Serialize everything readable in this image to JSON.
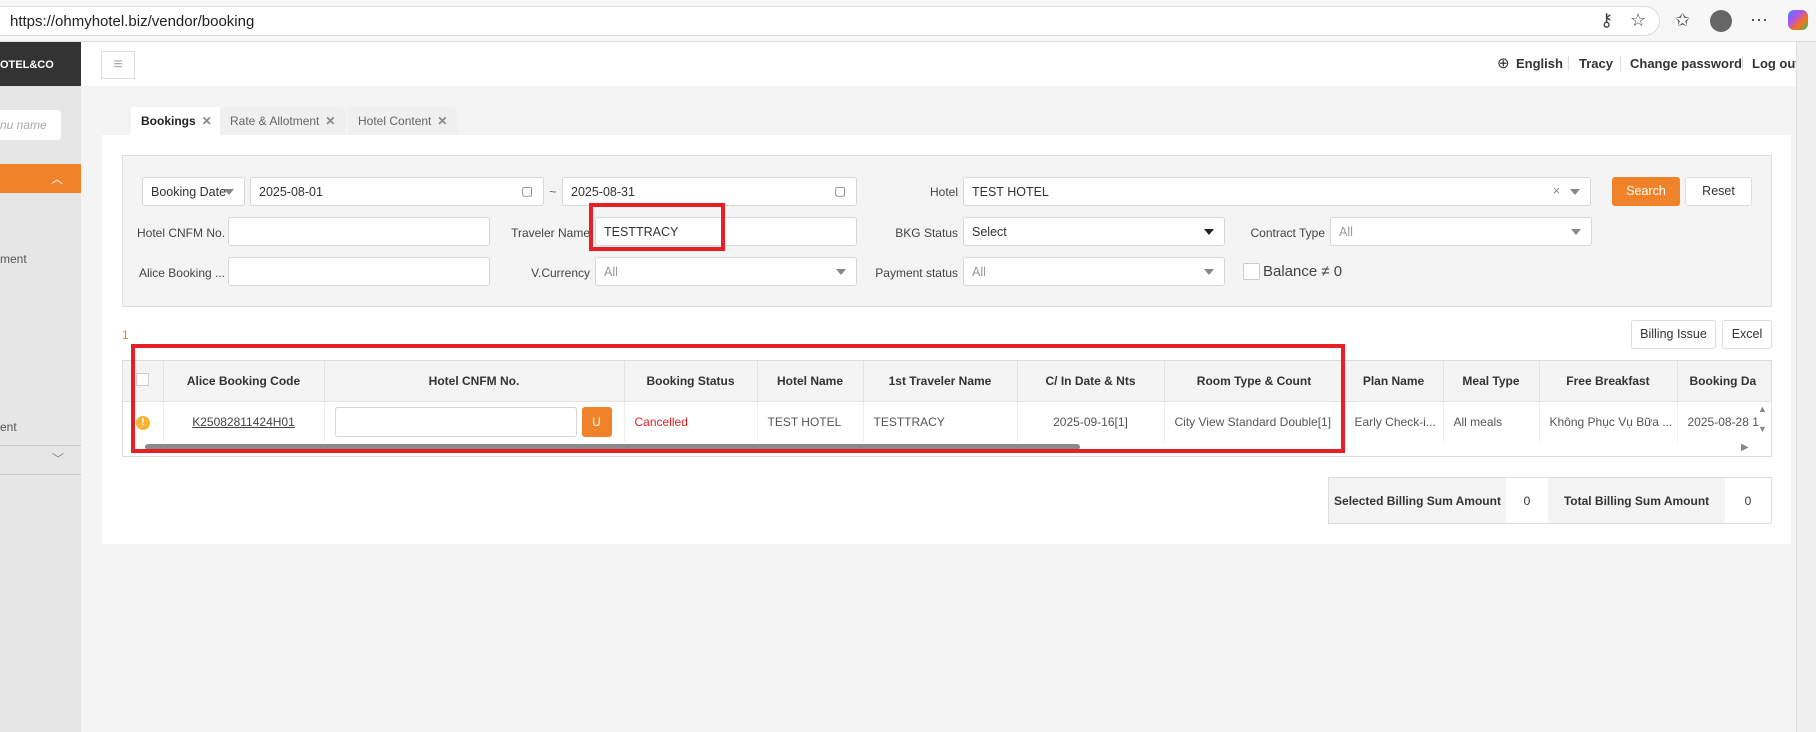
{
  "browser": {
    "url": "https://ohmyhotel.biz/vendor/booking"
  },
  "sidebar": {
    "logo": "OTEL&CO",
    "search_placeholder": "nu name",
    "items": [
      "ment",
      "ent"
    ]
  },
  "header": {
    "language": "English",
    "user": "Tracy",
    "change_password": "Change password",
    "logout": "Log out"
  },
  "tabs": [
    {
      "label": "Bookings",
      "active": true
    },
    {
      "label": "Rate & Allotment"
    },
    {
      "label": "Hotel Content"
    }
  ],
  "filters": {
    "date_type": "Booking Date",
    "date_from": "2025-08-01",
    "date_sep": "~",
    "date_to": "2025-08-31",
    "hotel_label": "Hotel",
    "hotel_value": "TEST HOTEL",
    "search": "Search",
    "reset": "Reset",
    "hotel_cnfm_label": "Hotel CNFM No.",
    "hotel_cnfm_value": "",
    "traveler_label": "Traveler Name",
    "traveler_value": "TESTTRACY",
    "bkg_status_label": "BKG Status",
    "bkg_status_value": "Select",
    "contract_label": "Contract Type",
    "contract_value": "All",
    "alice_label": "Alice Booking ...",
    "alice_value": "",
    "currency_label": "V.Currency",
    "currency_value": "All",
    "payment_label": "Payment status",
    "payment_value": "All",
    "balance_label": "Balance ≠ 0"
  },
  "results": {
    "count": "1",
    "billing_issue": "Billing Issue",
    "excel": "Excel"
  },
  "table": {
    "columns": [
      "Alice Booking Code",
      "Hotel CNFM No.",
      "Booking Status",
      "Hotel Name",
      "1st Traveler Name",
      "C/ In Date & Nts",
      "Room Type & Count",
      "Plan Name",
      "Meal Type",
      "Free Breakfast",
      "Booking Da"
    ],
    "rows": [
      {
        "code": "K25082811424H01",
        "cnfm": "",
        "u_button": "U",
        "status": "Cancelled",
        "hotel": "TEST HOTEL",
        "traveler": "TESTTRACY",
        "checkin": "2025-09-16[1]",
        "room": "City View Standard Double[1]",
        "plan": "Early Check-i...",
        "meal": "All meals",
        "breakfast": "Không Phục Vụ Bữa ...",
        "booking_date": "2025-08-28 1"
      }
    ]
  },
  "summary": {
    "selected_label": "Selected Billing Sum Amount",
    "selected_value": "0",
    "total_label": "Total Billing Sum Amount",
    "total_value": "0"
  },
  "colors": {
    "accent": "#f0822a",
    "cancelled": "#e81f25",
    "highlight": "#e81f25"
  }
}
